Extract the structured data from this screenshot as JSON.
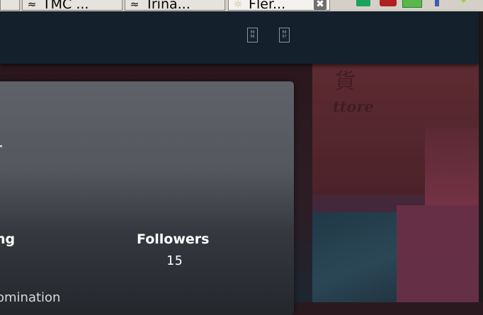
{
  "browser": {
    "tabs": [
      {
        "title": "TMC ...",
        "icon": "≈"
      },
      {
        "title": "Trina...",
        "icon": "≈"
      },
      {
        "title": "Fler...",
        "icon": "☼",
        "active": true
      }
    ],
    "close_glyph": "✖"
  },
  "nav": {
    "icon_a_code": "E0 06",
    "icon_b_code": "E0 07"
  },
  "background": {
    "sign_char": "貨",
    "sign_word": "ttore"
  },
  "profile": {
    "following_label": "ng",
    "followers_label": "Followers",
    "followers_count": "15",
    "description_fragment": "omination"
  },
  "colors": {
    "nav_bg": "#15202d",
    "card_top": "#5f6268",
    "card_bottom": "#24272c"
  }
}
